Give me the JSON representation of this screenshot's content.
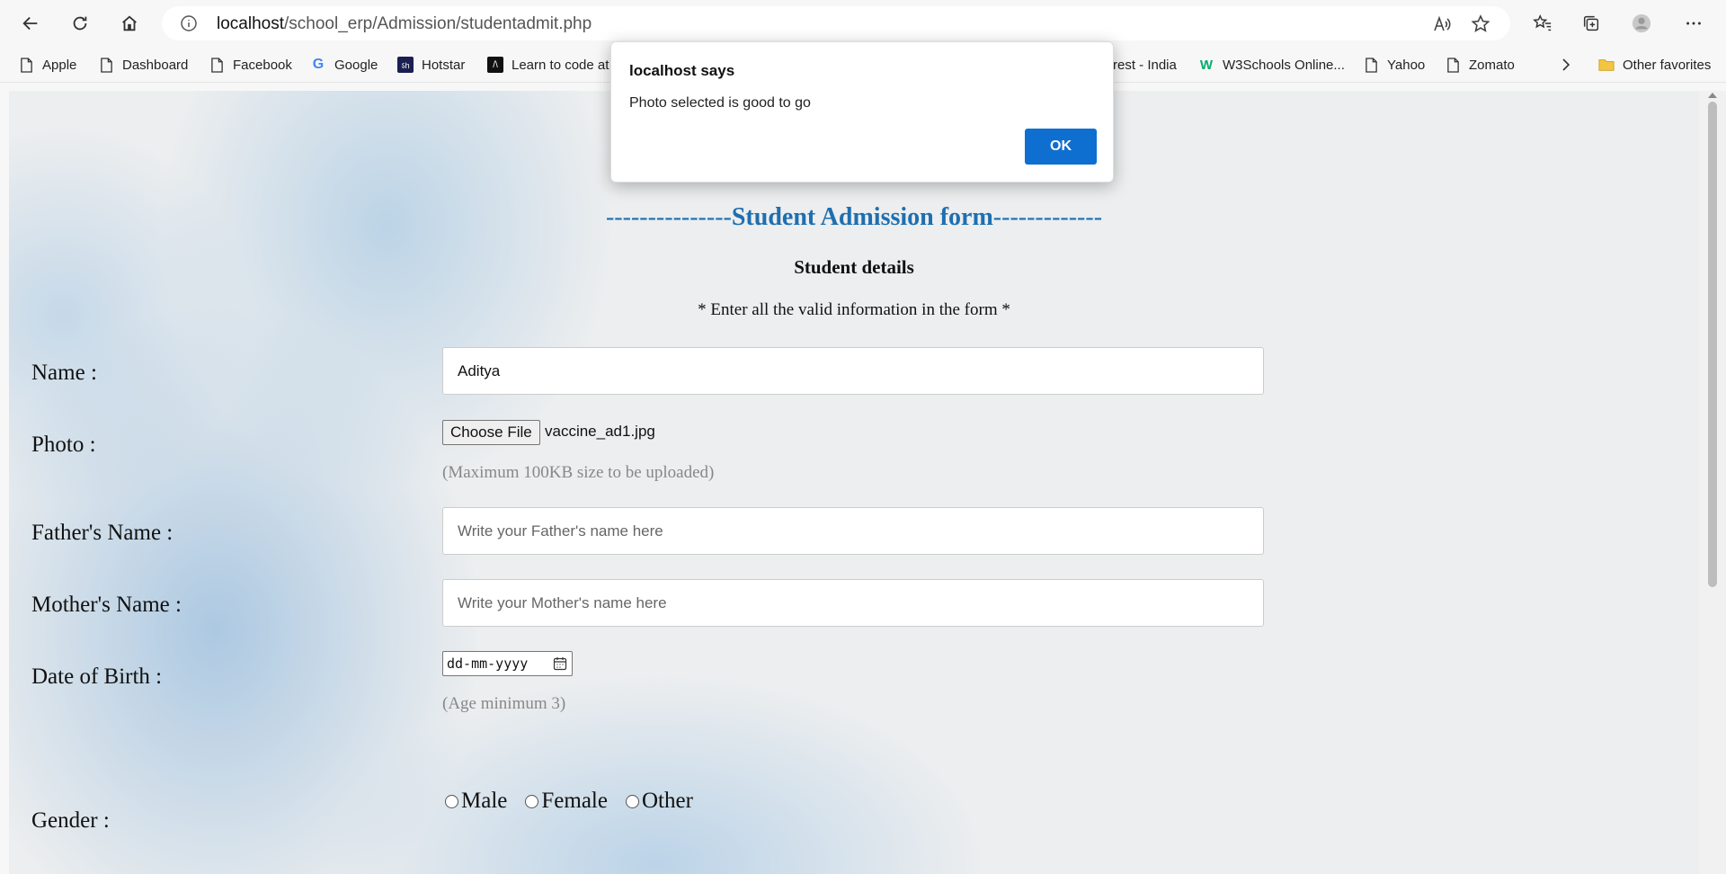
{
  "browser": {
    "url_host": "localhost",
    "url_path": "/school_erp/Admission/studentadmit.php",
    "bookmarks": [
      {
        "label": "Apple",
        "icon": "page-icon"
      },
      {
        "label": "Dashboard",
        "icon": "page-icon"
      },
      {
        "label": "Facebook",
        "icon": "page-icon"
      },
      {
        "label": "Google",
        "icon": "google-icon"
      },
      {
        "label": "Hotstar",
        "icon": "hotstar-icon"
      },
      {
        "label": "Learn to code at",
        "icon": "code-icon"
      },
      {
        "label": "rest - India",
        "icon": ""
      },
      {
        "label": "W3Schools Online...",
        "icon": "w3schools-icon"
      },
      {
        "label": "Yahoo",
        "icon": "page-icon"
      },
      {
        "label": "Zomato",
        "icon": "page-icon"
      }
    ],
    "other_favorites": "Other favorites"
  },
  "form": {
    "title_dashes_left": "---------------",
    "title_text": "Student Admission form",
    "title_dashes_right": "-------------",
    "subtitle": "Student details",
    "note": "* Enter all the valid information in the form *",
    "name_label": "Name :",
    "name_value": "Aditya",
    "photo_label": "Photo :",
    "choose_file": "Choose File",
    "file_name": "vaccine_ad1.jpg",
    "photo_hint": "(Maximum 100KB size to be uploaded)",
    "father_label": "Father's Name :",
    "father_placeholder": "Write your Father's name here",
    "mother_label": "Mother's Name :",
    "mother_placeholder": "Write your Mother's name here",
    "dob_label": "Date of Birth :",
    "dob_placeholder": "dd-mm-yyyy",
    "dob_hint": "(Age minimum 3)",
    "gender_label": "Gender :",
    "gender_options": [
      "Male",
      "Female",
      "Other"
    ]
  },
  "dialog": {
    "title": "localhost says",
    "message": "Photo selected is good to go",
    "ok": "OK"
  },
  "colors": {
    "title_blue": "#1e6fb0",
    "ok_button": "#0e6fd0"
  }
}
